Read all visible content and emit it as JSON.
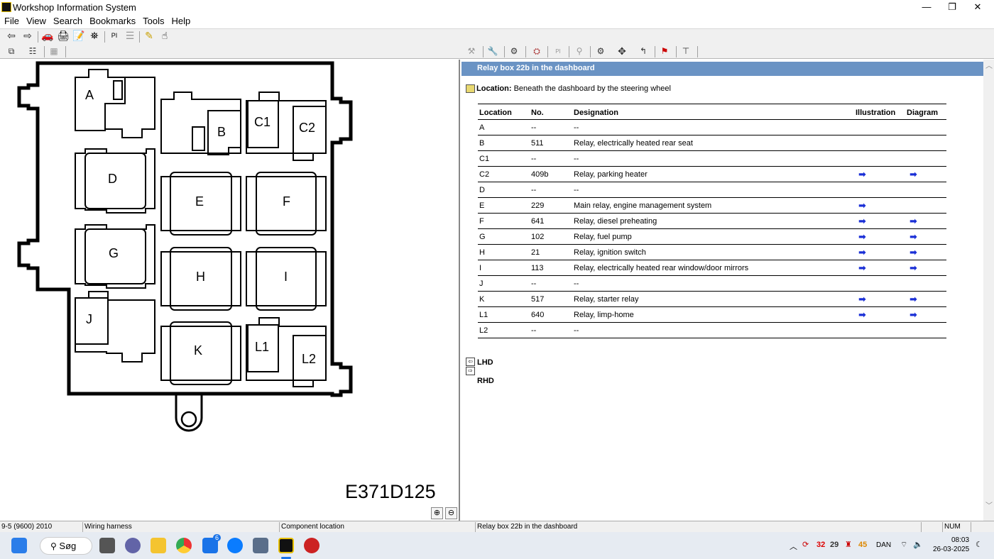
{
  "window": {
    "title": "Workshop Information System",
    "min": "—",
    "max": "❐",
    "close": "✕"
  },
  "menu": [
    "File",
    "View",
    "Search",
    "Bookmarks",
    "Tools",
    "Help"
  ],
  "toolbar": {
    "icons": [
      "back-arrow-icon",
      "forward-arrow-icon",
      "car-icon",
      "printer-icon",
      "notepad-icon",
      "binoculars-icon",
      "pi-icon",
      "bulletin-icon",
      "pencil-icon",
      "pointer-icon"
    ],
    "pi_label": "PI",
    "pi_label_2": "PI"
  },
  "drawing": {
    "code": "E371D125",
    "relays": [
      "A",
      "B",
      "C1",
      "C2",
      "D",
      "E",
      "F",
      "G",
      "H",
      "I",
      "J",
      "K",
      "L1",
      "L2"
    ]
  },
  "document": {
    "heading": "Relay box 22b in the dashboard",
    "location_label": "Location:",
    "location_text": "Beneath the dashboard by the steering wheel",
    "table": {
      "headers": [
        "Location",
        "No.",
        "Designation",
        "Illustration",
        "Diagram"
      ],
      "rows": [
        {
          "loc": "A",
          "no": "--",
          "des": "--",
          "ill": "",
          "dia": ""
        },
        {
          "loc": "B",
          "no": "511",
          "des": "Relay, electrically heated rear seat",
          "ill": "",
          "dia": ""
        },
        {
          "loc": "C1",
          "no": "--",
          "des": "--",
          "ill": "",
          "dia": ""
        },
        {
          "loc": "C2",
          "no": "409b",
          "des": "Relay, parking heater",
          "ill": "➡",
          "dia": "➡"
        },
        {
          "loc": "D",
          "no": "--",
          "des": "--",
          "ill": "",
          "dia": ""
        },
        {
          "loc": "E",
          "no": "229",
          "des": "Main relay, engine management system",
          "ill": "➡",
          "dia": ""
        },
        {
          "loc": "F",
          "no": "641",
          "des": "Relay, diesel preheating",
          "ill": "➡",
          "dia": "➡"
        },
        {
          "loc": "G",
          "no": "102",
          "des": "Relay, fuel pump",
          "ill": "➡",
          "dia": "➡"
        },
        {
          "loc": "H",
          "no": "21",
          "des": "Relay, ignition switch",
          "ill": "➡",
          "dia": "➡"
        },
        {
          "loc": "I",
          "no": "113",
          "des": "Relay, electrically heated rear window/door mirrors",
          "ill": "➡",
          "dia": "➡"
        },
        {
          "loc": "J",
          "no": "--",
          "des": "--",
          "ill": "",
          "dia": ""
        },
        {
          "loc": "K",
          "no": "517",
          "des": "Relay, starter relay",
          "ill": "➡",
          "dia": "➡"
        },
        {
          "loc": "L1",
          "no": "640",
          "des": "Relay, limp-home",
          "ill": "➡",
          "dia": "➡"
        },
        {
          "loc": "L2",
          "no": "--",
          "des": "--",
          "ill": "",
          "dia": ""
        }
      ]
    },
    "lhd": "LHD",
    "rhd": "RHD"
  },
  "status": {
    "model": "9-5 (9600) 2010",
    "section": "Wiring harness",
    "subsection": "Component location",
    "doc": "Relay box 22b in the dashboard",
    "num": "NUM"
  },
  "taskbar": {
    "search": "Søg",
    "mail_badge": "6",
    "tray_a": "32",
    "tray_b": "29",
    "tray_c": "45",
    "lang": "DAN",
    "time": "08:03",
    "date": "26-03-2025"
  }
}
